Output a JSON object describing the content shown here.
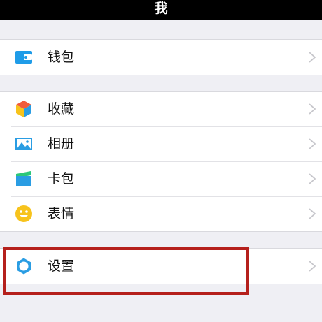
{
  "header": {
    "title": "我"
  },
  "groups": [
    {
      "items": [
        {
          "label": "钱包",
          "icon": "wallet-icon"
        }
      ]
    },
    {
      "items": [
        {
          "label": "收藏",
          "icon": "favorites-cube-icon"
        },
        {
          "label": "相册",
          "icon": "album-picture-icon"
        },
        {
          "label": "卡包",
          "icon": "card-pack-icon"
        },
        {
          "label": "表情",
          "icon": "emoji-smile-icon"
        }
      ]
    },
    {
      "items": [
        {
          "label": "设置",
          "icon": "settings-gear-icon"
        }
      ]
    }
  ],
  "annotation": {
    "highlighted_item": "设置",
    "color": "#b5201c"
  },
  "colors": {
    "topbar": "#000000",
    "background": "#efeff4",
    "icon_blue": "#2a9de3",
    "icon_yellow": "#f7c31c",
    "icon_green": "#2cc77a"
  }
}
